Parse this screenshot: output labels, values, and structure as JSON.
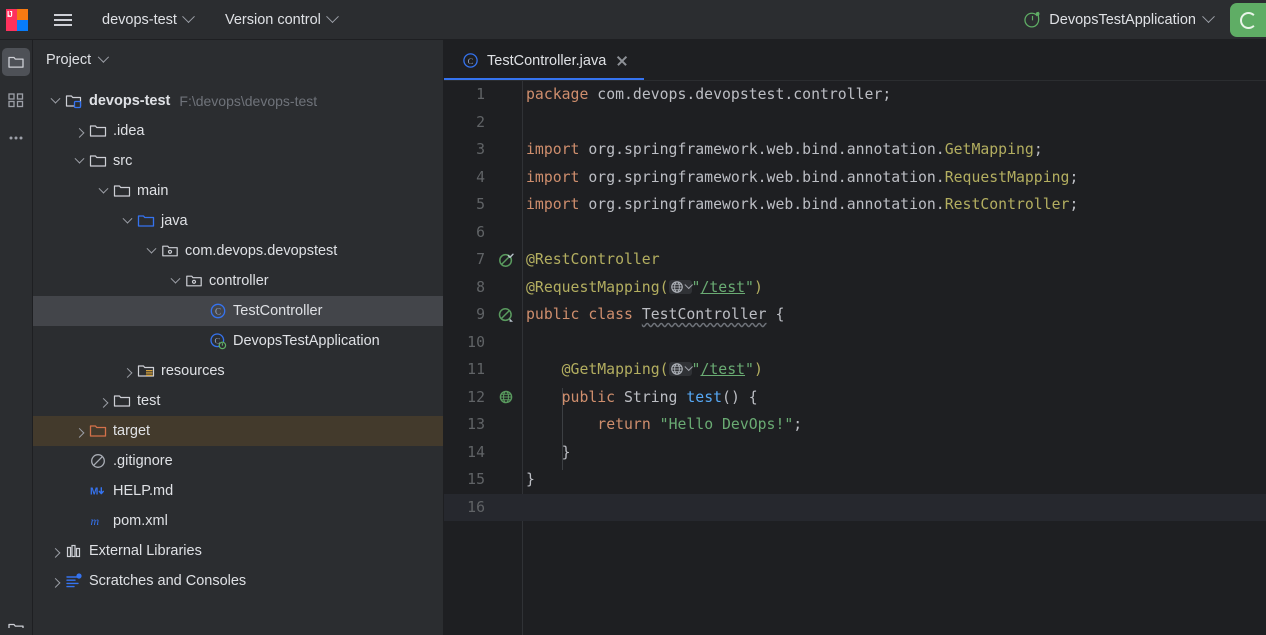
{
  "toolbar": {
    "logo_name": "intellij-idea-logo",
    "menu_label": "main-menu",
    "project_name": "devops-test",
    "version_control_label": "Version control",
    "run_configuration": "DevopsTestApplication",
    "run_button_label": "Run",
    "green_action_label": "Running indicator"
  },
  "toolstrip": {
    "items": [
      {
        "name": "project-tool-window",
        "icon": "folder-icon",
        "active": true
      },
      {
        "name": "commit-tool-window",
        "icon": "commit-icon",
        "active": false
      },
      {
        "name": "more-tool-windows",
        "icon": "more-dots-icon",
        "active": false
      }
    ]
  },
  "project_panel": {
    "title": "Project",
    "tree": [
      {
        "depth": 0,
        "arrow": "down",
        "icon": "module-folder-icon",
        "label": "devops-test",
        "path": "F:\\devops\\devops-test",
        "bold": true,
        "state": "normal"
      },
      {
        "depth": 1,
        "arrow": "right",
        "icon": "folder-icon",
        "label": ".idea",
        "path": "",
        "bold": false,
        "state": "normal"
      },
      {
        "depth": 1,
        "arrow": "down",
        "icon": "folder-icon",
        "label": "src",
        "path": "",
        "bold": false,
        "state": "normal"
      },
      {
        "depth": 2,
        "arrow": "down",
        "icon": "folder-icon",
        "label": "main",
        "path": "",
        "bold": false,
        "state": "normal"
      },
      {
        "depth": 3,
        "arrow": "down",
        "icon": "source-folder-icon",
        "label": "java",
        "path": "",
        "bold": false,
        "state": "normal"
      },
      {
        "depth": 4,
        "arrow": "down",
        "icon": "package-icon",
        "label": "com.devops.devopstest",
        "path": "",
        "bold": false,
        "state": "normal"
      },
      {
        "depth": 5,
        "arrow": "down",
        "icon": "package-icon",
        "label": "controller",
        "path": "",
        "bold": false,
        "state": "normal"
      },
      {
        "depth": 6,
        "arrow": "none",
        "icon": "java-class-icon",
        "label": "TestController",
        "path": "",
        "bold": false,
        "state": "selected"
      },
      {
        "depth": 6,
        "arrow": "none",
        "icon": "spring-class-icon",
        "label": "DevopsTestApplication",
        "path": "",
        "bold": false,
        "state": "normal"
      },
      {
        "depth": 3,
        "arrow": "right",
        "icon": "resources-folder-icon",
        "label": "resources",
        "path": "",
        "bold": false,
        "state": "normal"
      },
      {
        "depth": 2,
        "arrow": "right",
        "icon": "folder-icon",
        "label": "test",
        "path": "",
        "bold": false,
        "state": "normal"
      },
      {
        "depth": 1,
        "arrow": "right",
        "icon": "excluded-folder-icon",
        "label": "target",
        "path": "",
        "bold": false,
        "state": "excluded"
      },
      {
        "depth": 1,
        "arrow": "none",
        "icon": "gitignore-icon",
        "label": ".gitignore",
        "path": "",
        "bold": false,
        "state": "normal"
      },
      {
        "depth": 1,
        "arrow": "none",
        "icon": "markdown-icon",
        "label": "HELP.md",
        "path": "",
        "bold": false,
        "state": "normal"
      },
      {
        "depth": 1,
        "arrow": "none",
        "icon": "maven-icon",
        "label": "pom.xml",
        "path": "",
        "bold": false,
        "state": "normal"
      },
      {
        "depth": 0,
        "arrow": "right",
        "icon": "libraries-icon",
        "label": "External Libraries",
        "path": "",
        "bold": false,
        "state": "normal"
      },
      {
        "depth": 0,
        "arrow": "right",
        "icon": "scratches-icon",
        "label": "Scratches and Consoles",
        "path": "",
        "bold": false,
        "state": "normal"
      }
    ]
  },
  "editor": {
    "tabs": [
      {
        "label": "TestController.java",
        "icon": "java-class-icon",
        "active": true,
        "close_label": "Close tab"
      }
    ],
    "caret_line": 16,
    "lines": [
      {
        "no": 1,
        "gutter": "none",
        "indent": 0,
        "text": "package com.devops.devopstest.controller;"
      },
      {
        "no": 2,
        "gutter": "none",
        "indent": 0,
        "text": ""
      },
      {
        "no": 3,
        "gutter": "none",
        "indent": 0,
        "text": "import org.springframework.web.bind.annotation.GetMapping;"
      },
      {
        "no": 4,
        "gutter": "none",
        "indent": 0,
        "text": "import org.springframework.web.bind.annotation.RequestMapping;"
      },
      {
        "no": 5,
        "gutter": "none",
        "indent": 0,
        "text": "import org.springframework.web.bind.annotation.RestController;"
      },
      {
        "no": 6,
        "gutter": "none",
        "indent": 0,
        "text": ""
      },
      {
        "no": 7,
        "gutter": "spring-bean-check-icon",
        "indent": 0,
        "text": "@RestController"
      },
      {
        "no": 8,
        "gutter": "none",
        "indent": 0,
        "text": "@RequestMapping(\"/test\")"
      },
      {
        "no": 9,
        "gutter": "spring-bean-icon",
        "indent": 0,
        "text": "public class TestController {"
      },
      {
        "no": 10,
        "gutter": "none",
        "indent": 0,
        "text": ""
      },
      {
        "no": 11,
        "gutter": "none",
        "indent": 1,
        "text": "@GetMapping(\"/test\")"
      },
      {
        "no": 12,
        "gutter": "web-endpoint-icon",
        "indent": 1,
        "text": "public String test() {"
      },
      {
        "no": 13,
        "gutter": "none",
        "indent": 2,
        "text": "return \"Hello DevOps!\";"
      },
      {
        "no": 14,
        "gutter": "none",
        "indent": 1,
        "text": "}"
      },
      {
        "no": 15,
        "gutter": "none",
        "indent": 0,
        "text": "}"
      },
      {
        "no": 16,
        "gutter": "none",
        "indent": 0,
        "text": ""
      }
    ],
    "mapping_value": "/test",
    "string_literal": "Hello DevOps!"
  },
  "colors": {
    "background": "#1e1f22",
    "panel": "#2b2d30",
    "accent_blue": "#3573f0",
    "keyword_orange": "#cf8e6d",
    "annotation_olive": "#b3ae60",
    "string_green": "#6aab73",
    "method_blue": "#56a8f5",
    "run_green": "#5fad65",
    "excluded_brown": "#433a2c"
  }
}
